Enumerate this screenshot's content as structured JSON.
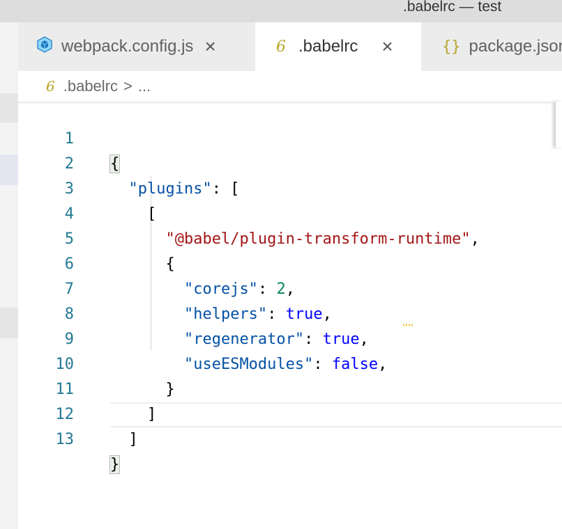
{
  "window": {
    "title": ".babelrc — test"
  },
  "tabs": [
    {
      "label": "webpack.config.js",
      "icon": "webpack-cube-icon",
      "active": false
    },
    {
      "label": ".babelrc",
      "icon": "babel-six-icon",
      "active": true
    },
    {
      "label": "package.json",
      "icon": "json-braces-icon",
      "active": false
    }
  ],
  "icon_glyphs": {
    "six": "6",
    "braces": "{}",
    "close": "×",
    "chevron": "›"
  },
  "breadcrumb": {
    "file": ".babelrc",
    "separator": ">",
    "more": "..."
  },
  "editor": {
    "line_numbers": [
      "1",
      "2",
      "3",
      "4",
      "5",
      "6",
      "7",
      "8",
      "9",
      "10",
      "11",
      "12",
      "13"
    ],
    "code": {
      "l1_open": "{",
      "l2_key": "\"plugins\"",
      "l2_rest": ": [",
      "l3_open": "[",
      "l4_str": "\"@babel/plugin-transform-runtime\"",
      "l4_rest": ",",
      "l5_open": "{",
      "l6_key": "\"corejs\"",
      "l6_sep": ": ",
      "l6_val": "2",
      "l6_rest": ",",
      "l7_key": "\"helpers\"",
      "l7_sep": ": ",
      "l7_val": "true",
      "l7_rest": ",",
      "l8_key": "\"regenerator\"",
      "l8_sep": ": ",
      "l8_val": "true",
      "l8_rest": ",",
      "l9_key": "\"useESModules\"",
      "l9_sep": ": ",
      "l9_val": "false",
      "l9_rest": ",",
      "l10_close": "}",
      "l11_close": "]",
      "l12_close": "]",
      "l13_close": "}"
    },
    "current_line": "13",
    "warning_on_line": "9"
  },
  "colors": {
    "key": "#0451a5",
    "string": "#a31515",
    "number": "#098658",
    "keyword": "#0000ff",
    "line_number": "#237893",
    "babel_icon": "#b8a52c"
  }
}
